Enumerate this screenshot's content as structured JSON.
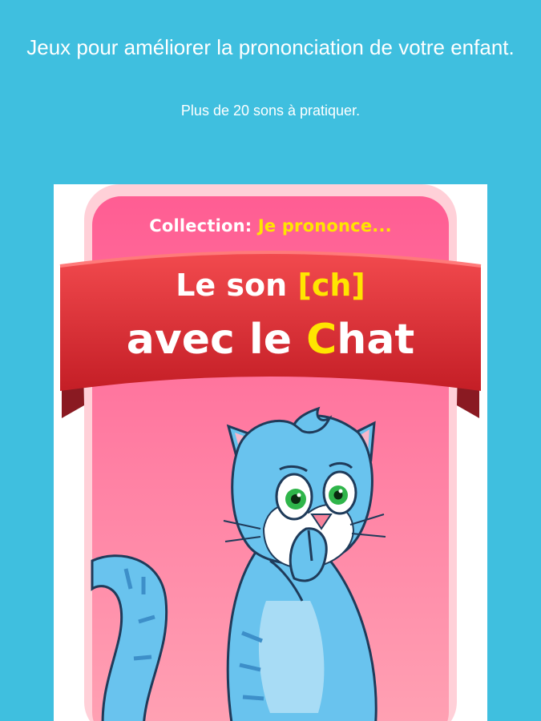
{
  "header": {
    "headline": "Jeux pour améliorer la prononciation de votre enfant.",
    "subline": "Plus de 20 sons à pratiquer."
  },
  "card": {
    "collection_label": "Collection:",
    "collection_name": "Je prononce...",
    "title_line1_prefix": "Le son",
    "title_line1_sound": "[ch]",
    "title_line2_prefix": "avec le",
    "title_line2_highlight": "C",
    "title_line2_suffix": "hat",
    "illustration": "blue-cat-shush"
  },
  "colors": {
    "background": "#3fbfdf",
    "card_pink": "#ff6a9a",
    "banner_red": "#e8383e",
    "highlight_yellow": "#ffe500",
    "cat_blue": "#69c3ee"
  }
}
